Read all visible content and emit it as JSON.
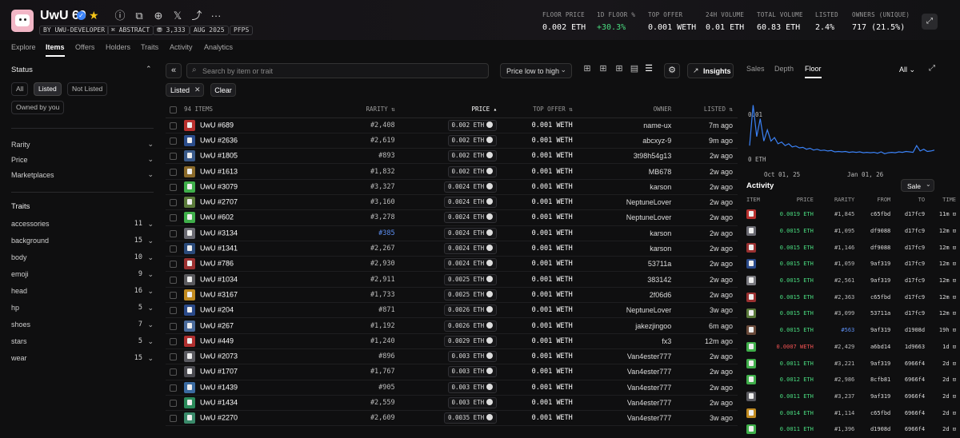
{
  "collection": {
    "name": "UwU 69",
    "chips": [
      "BY UWU-DEVELOPER",
      "⌘ ABSTRACT",
      "⛃ 3,333",
      "AUG 2025",
      "PFPS"
    ]
  },
  "stats": [
    {
      "label": "FLOOR PRICE",
      "value": "0.002 ETH"
    },
    {
      "label": "1D FLOOR %",
      "value": "+30.3%",
      "color": "#4ade80"
    },
    {
      "label": "TOP OFFER",
      "value": "0.001 WETH"
    },
    {
      "label": "24H VOLUME",
      "value": "0.01 ETH"
    },
    {
      "label": "TOTAL VOLUME",
      "value": "60.83 ETH"
    },
    {
      "label": "LISTED",
      "value": "2.4%"
    },
    {
      "label": "OWNERS (UNIQUE)",
      "value": "717 (21.5%)"
    }
  ],
  "nav_tabs": [
    "Explore",
    "Items",
    "Offers",
    "Holders",
    "Traits",
    "Activity",
    "Analytics"
  ],
  "sidebar": {
    "status_title": "Status",
    "status_buttons": [
      "All",
      "Listed",
      "Not Listed",
      "Owned by you"
    ],
    "filters": [
      "Rarity",
      "Price",
      "Marketplaces"
    ],
    "traits_title": "Traits",
    "traits": [
      {
        "name": "accessories",
        "count": "11"
      },
      {
        "name": "background",
        "count": "15"
      },
      {
        "name": "body",
        "count": "10"
      },
      {
        "name": "emoji",
        "count": "9"
      },
      {
        "name": "head",
        "count": "16"
      },
      {
        "name": "hp",
        "count": "5"
      },
      {
        "name": "shoes",
        "count": "7"
      },
      {
        "name": "stars",
        "count": "5"
      },
      {
        "name": "wear",
        "count": "15"
      }
    ]
  },
  "toolbar": {
    "search_placeholder": "Search by item or trait",
    "sort_label": "Price low to high",
    "insights_label": "Insights",
    "filter_tag": "Listed",
    "clear_label": "Clear"
  },
  "items_table": {
    "headers": [
      "94 ITEMS",
      "RARITY",
      "PRICE",
      "TOP OFFER",
      "OWNER",
      "LISTED"
    ],
    "rows": [
      {
        "name": "UwU #689",
        "rarity": "#2,408",
        "price": "0.002 ETH",
        "offer": "0.001 WETH",
        "owner": "name-ux",
        "listed": "7m ago",
        "thumb": "#b8312f"
      },
      {
        "name": "UwU #2636",
        "rarity": "#2,619",
        "price": "0.002 ETH",
        "offer": "0.001 WETH",
        "owner": "abcxyz-9",
        "listed": "9m ago",
        "thumb": "#2b4d8c"
      },
      {
        "name": "UwU #1805",
        "rarity": "#893",
        "price": "0.002 ETH",
        "offer": "0.001 WETH",
        "owner": "3t98h54g13",
        "listed": "2w ago",
        "thumb": "#3a5a8a"
      },
      {
        "name": "UwU #1613",
        "rarity": "#1,832",
        "price": "0.002 ETH",
        "offer": "0.001 WETH",
        "owner": "MB678",
        "listed": "2w ago",
        "thumb": "#8a6a2a"
      },
      {
        "name": "UwU #3079",
        "rarity": "#3,327",
        "price": "0.0024 ETH",
        "offer": "0.001 WETH",
        "owner": "karson",
        "listed": "2w ago",
        "thumb": "#3fae4a"
      },
      {
        "name": "UwU #2707",
        "rarity": "#3,160",
        "price": "0.0024 ETH",
        "offer": "0.001 WETH",
        "owner": "NeptuneLover",
        "listed": "2w ago",
        "thumb": "#5a7a3a"
      },
      {
        "name": "UwU #602",
        "rarity": "#3,278",
        "price": "0.0024 ETH",
        "offer": "0.001 WETH",
        "owner": "NeptuneLover",
        "listed": "2w ago",
        "thumb": "#3fae4a"
      },
      {
        "name": "UwU #3134",
        "rarity": "#385",
        "price": "0.0024 ETH",
        "offer": "0.001 WETH",
        "owner": "karson",
        "listed": "2w ago",
        "thumb": "#6a6a72",
        "rarity_color": "#5b8def"
      },
      {
        "name": "UwU #1341",
        "rarity": "#2,267",
        "price": "0.0024 ETH",
        "offer": "0.001 WETH",
        "owner": "karson",
        "listed": "2w ago",
        "thumb": "#2a4a7a"
      },
      {
        "name": "UwU #786",
        "rarity": "#2,930",
        "price": "0.0024 ETH",
        "offer": "0.001 WETH",
        "owner": "53711a",
        "listed": "2w ago",
        "thumb": "#9a3030"
      },
      {
        "name": "UwU #1034",
        "rarity": "#2,911",
        "price": "0.0025 ETH",
        "offer": "0.001 WETH",
        "owner": "383142",
        "listed": "2w ago",
        "thumb": "#5a5a5e"
      },
      {
        "name": "UwU #3167",
        "rarity": "#1,733",
        "price": "0.0025 ETH",
        "offer": "0.001 WETH",
        "owner": "2f06d6",
        "listed": "2w ago",
        "thumb": "#c08a20"
      },
      {
        "name": "UwU #204",
        "rarity": "#871",
        "price": "0.0026 ETH",
        "offer": "0.001 WETH",
        "owner": "NeptuneLover",
        "listed": "3w ago",
        "thumb": "#2a4a8a"
      },
      {
        "name": "UwU #267",
        "rarity": "#1,192",
        "price": "0.0026 ETH",
        "offer": "0.001 WETH",
        "owner": "jakezjingoo",
        "listed": "6m ago",
        "thumb": "#4a6a9a"
      },
      {
        "name": "UwU #449",
        "rarity": "#1,240",
        "price": "0.0029 ETH",
        "offer": "0.001 WETH",
        "owner": "fx3",
        "listed": "12m ago",
        "thumb": "#b03030"
      },
      {
        "name": "UwU #2073",
        "rarity": "#896",
        "price": "0.003 ETH",
        "offer": "0.001 WETH",
        "owner": "Van4ester777",
        "listed": "2w ago",
        "thumb": "#5a5a60"
      },
      {
        "name": "UwU #1707",
        "rarity": "#1,767",
        "price": "0.003 ETH",
        "offer": "0.001 WETH",
        "owner": "Van4ester777",
        "listed": "2w ago",
        "thumb": "#4a4a50"
      },
      {
        "name": "UwU #1439",
        "rarity": "#905",
        "price": "0.003 ETH",
        "offer": "0.001 WETH",
        "owner": "Van4ester777",
        "listed": "2w ago",
        "thumb": "#3a6aa0"
      },
      {
        "name": "UwU #1434",
        "rarity": "#2,559",
        "price": "0.003 ETH",
        "offer": "0.001 WETH",
        "owner": "Van4ester777",
        "listed": "2w ago",
        "thumb": "#2a8a5a"
      },
      {
        "name": "UwU #2270",
        "rarity": "#2,609",
        "price": "0.0035 ETH",
        "offer": "0.001 WETH",
        "owner": "Van4ester777",
        "listed": "3w ago",
        "thumb": "#3a8a6a"
      }
    ]
  },
  "right_panel": {
    "tabs": [
      "Sales",
      "Depth",
      "Floor"
    ],
    "range": "All",
    "activity_title": "Activity",
    "activity_filter": "Sale",
    "headers": [
      "ITEM",
      "PRICE",
      "RARITY",
      "FROM",
      "TO",
      "TIME"
    ],
    "rows": [
      {
        "price": "0.0019 ETH",
        "rarity": "#1,845",
        "from": "c65fbd",
        "to": "d17fc9",
        "time": "11m",
        "thumb": "#b8312f"
      },
      {
        "price": "0.0015 ETH",
        "rarity": "#1,095",
        "from": "df9088",
        "to": "d17fc9",
        "time": "12m",
        "thumb": "#6a6a72"
      },
      {
        "price": "0.0015 ETH",
        "rarity": "#1,146",
        "from": "df9088",
        "to": "d17fc9",
        "time": "12m",
        "thumb": "#9a3030"
      },
      {
        "price": "0.0015 ETH",
        "rarity": "#1,059",
        "from": "9af319",
        "to": "d17fc9",
        "time": "12m",
        "thumb": "#2a4a8a"
      },
      {
        "price": "0.0015 ETH",
        "rarity": "#2,561",
        "from": "9af319",
        "to": "d17fc9",
        "time": "12m",
        "thumb": "#7a7a80"
      },
      {
        "price": "0.0015 ETH",
        "rarity": "#2,363",
        "from": "c65fbd",
        "to": "d17fc9",
        "time": "12m",
        "thumb": "#9a3030"
      },
      {
        "price": "0.0015 ETH",
        "rarity": "#3,099",
        "from": "53711a",
        "to": "d17fc9",
        "time": "12m",
        "thumb": "#5a7a3a"
      },
      {
        "price": "0.0015 ETH",
        "rarity": "#563",
        "from": "9af319",
        "to": "d1908d",
        "time": "19h",
        "thumb": "#6a4a3a",
        "rarity_color": "#5b8def"
      },
      {
        "price": "0.0007 WETH",
        "rarity": "#2,429",
        "from": "a6bd14",
        "to": "1d9663",
        "time": "1d",
        "thumb": "#3fae4a",
        "price_color": "#f05252"
      },
      {
        "price": "0.0011 ETH",
        "rarity": "#3,221",
        "from": "9af319",
        "to": "6966f4",
        "time": "2d",
        "thumb": "#3fae4a"
      },
      {
        "price": "0.0012 ETH",
        "rarity": "#2,986",
        "from": "8cfb81",
        "to": "6966f4",
        "time": "2d",
        "thumb": "#3fae4a"
      },
      {
        "price": "0.0011 ETH",
        "rarity": "#3,237",
        "from": "9af319",
        "to": "6966f4",
        "time": "2d",
        "thumb": "#5a5a60"
      },
      {
        "price": "0.0014 ETH",
        "rarity": "#1,114",
        "from": "c65fbd",
        "to": "6966f4",
        "time": "2d",
        "thumb": "#c08a20"
      },
      {
        "price": "0.0011 ETH",
        "rarity": "#1,396",
        "from": "d1908d",
        "to": "6966f4",
        "time": "2d",
        "thumb": "#3fae4a"
      }
    ]
  },
  "chart_data": {
    "type": "line",
    "series": [
      {
        "values": [
          0.003,
          0.012,
          0.005,
          0.009,
          0.004,
          0.0065,
          0.004,
          0.0048,
          0.0034,
          0.0038,
          0.003,
          0.0034,
          0.0027,
          0.0029,
          0.0025,
          0.0026,
          0.0022,
          0.0024,
          0.002,
          0.0022,
          0.0019,
          0.002,
          0.0018,
          0.0019,
          0.0016,
          0.0017,
          0.0016,
          0.0017,
          0.0015,
          0.0016,
          0.0015,
          0.0016,
          0.0014,
          0.0015,
          0.0014,
          0.0015,
          0.0013,
          0.0016,
          0.0012,
          0.0014,
          0.0015,
          0.0014,
          0.0016,
          0.0015,
          0.0017,
          0.0016,
          0.0015,
          0.003,
          0.0018,
          0.0022,
          0.0017,
          0.0018,
          0.002
        ]
      }
    ],
    "y_ticks": [
      "0.01",
      "0 ETH"
    ],
    "x_ticks": [
      "Oct 01, 25",
      "Jan 01, 26"
    ],
    "ylim": [
      0,
      0.0155
    ],
    "color": "#3b82f6",
    "grid": false
  }
}
